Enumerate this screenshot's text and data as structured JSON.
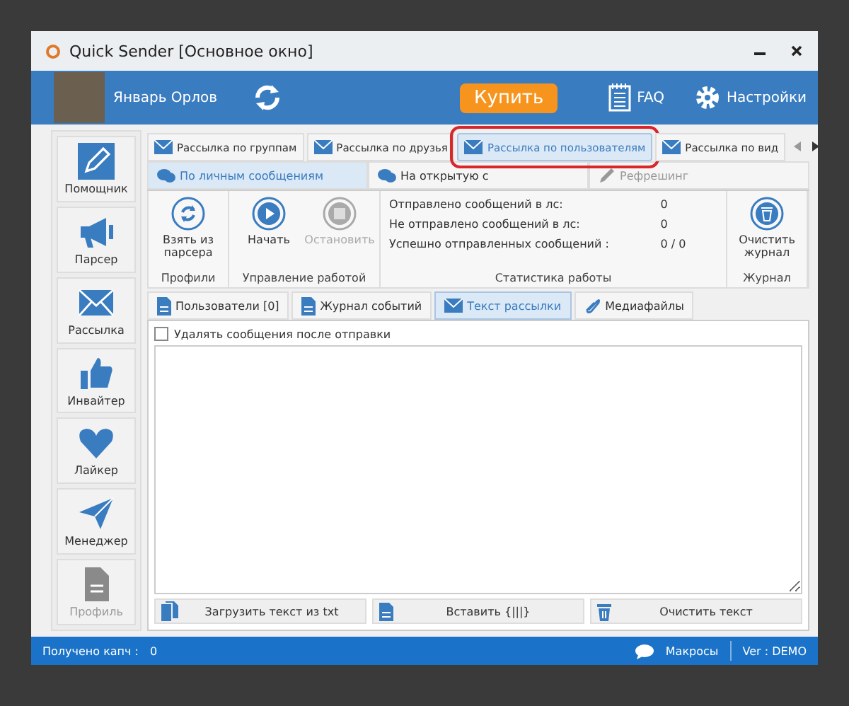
{
  "window": {
    "title": "Quick Sender [Основное окно]"
  },
  "header": {
    "user_name": "Январь Орлов",
    "buy_button": "Купить",
    "faq": "FAQ",
    "settings": "Настройки"
  },
  "sidebar": {
    "items": [
      {
        "label": "Помощник",
        "kind": "pencil",
        "disabled": false
      },
      {
        "label": "Парсер",
        "kind": "megaphone",
        "disabled": false
      },
      {
        "label": "Рассылка",
        "kind": "envelope",
        "disabled": false
      },
      {
        "label": "Инвайтер",
        "kind": "thumb",
        "disabled": false
      },
      {
        "label": "Лайкер",
        "kind": "heart",
        "disabled": false
      },
      {
        "label": "Менеджер",
        "kind": "plane",
        "disabled": false
      },
      {
        "label": "Профиль",
        "kind": "document",
        "disabled": true
      }
    ]
  },
  "mode_tabs": [
    {
      "label": "Рассылка по группам",
      "selected": false,
      "highlighted": false
    },
    {
      "label": "Рассылка по друзья",
      "selected": false,
      "highlighted": false
    },
    {
      "label": "Рассылка по пользователям",
      "selected": true,
      "highlighted": true
    },
    {
      "label": "Рассылка по вид",
      "selected": false,
      "highlighted": false
    }
  ],
  "sub_tabs": [
    {
      "label": "По личным сообщениям",
      "kind": "chat",
      "selected": true
    },
    {
      "label": "На открытую с",
      "kind": "chat",
      "selected": false
    },
    {
      "label": "Рефрешинг",
      "kind": "pen",
      "selected": false
    }
  ],
  "ribbon": {
    "groups": [
      {
        "label": "Профили",
        "buttons": [
          {
            "label": "Взять из парсера",
            "kind": "refresh",
            "disabled": false
          }
        ]
      },
      {
        "label": "Управление работой",
        "buttons": [
          {
            "label": "Начать",
            "kind": "play",
            "disabled": false
          },
          {
            "label": "Остановить",
            "kind": "stop",
            "disabled": true
          }
        ]
      },
      {
        "label": "Статистика работы",
        "stats": [
          {
            "label": "Отправлено сообщений в лс:",
            "value": "0"
          },
          {
            "label": "Не отправлено сообщений в лс:",
            "value": "0"
          },
          {
            "label": "Успешно отправленных сообщений :",
            "value": "0 / 0"
          }
        ]
      },
      {
        "label": "Журнал",
        "buttons": [
          {
            "label": "Очистить журнал",
            "kind": "trash",
            "disabled": false
          }
        ]
      }
    ]
  },
  "inner_tabs": [
    {
      "label": "Пользователи [0]",
      "kind": "doc",
      "selected": false
    },
    {
      "label": "Журнал событий",
      "kind": "doc",
      "selected": false
    },
    {
      "label": "Текст рассылки",
      "kind": "envelope",
      "selected": true
    },
    {
      "label": "Медиафайлы",
      "kind": "clip",
      "selected": false
    }
  ],
  "delete_after_send": {
    "label": "Удалять сообщения после отправки",
    "checked": false
  },
  "actions": [
    {
      "label": "Загрузить текст из txt",
      "kind": "files"
    },
    {
      "label": "Вставить {|||}",
      "kind": "doc"
    },
    {
      "label": "Очистить текст",
      "kind": "trash"
    }
  ],
  "status_bar": {
    "captcha_label": "Получено капч :",
    "captcha_value": "0",
    "macros": "Макросы",
    "version": "Ver : DEMO"
  }
}
